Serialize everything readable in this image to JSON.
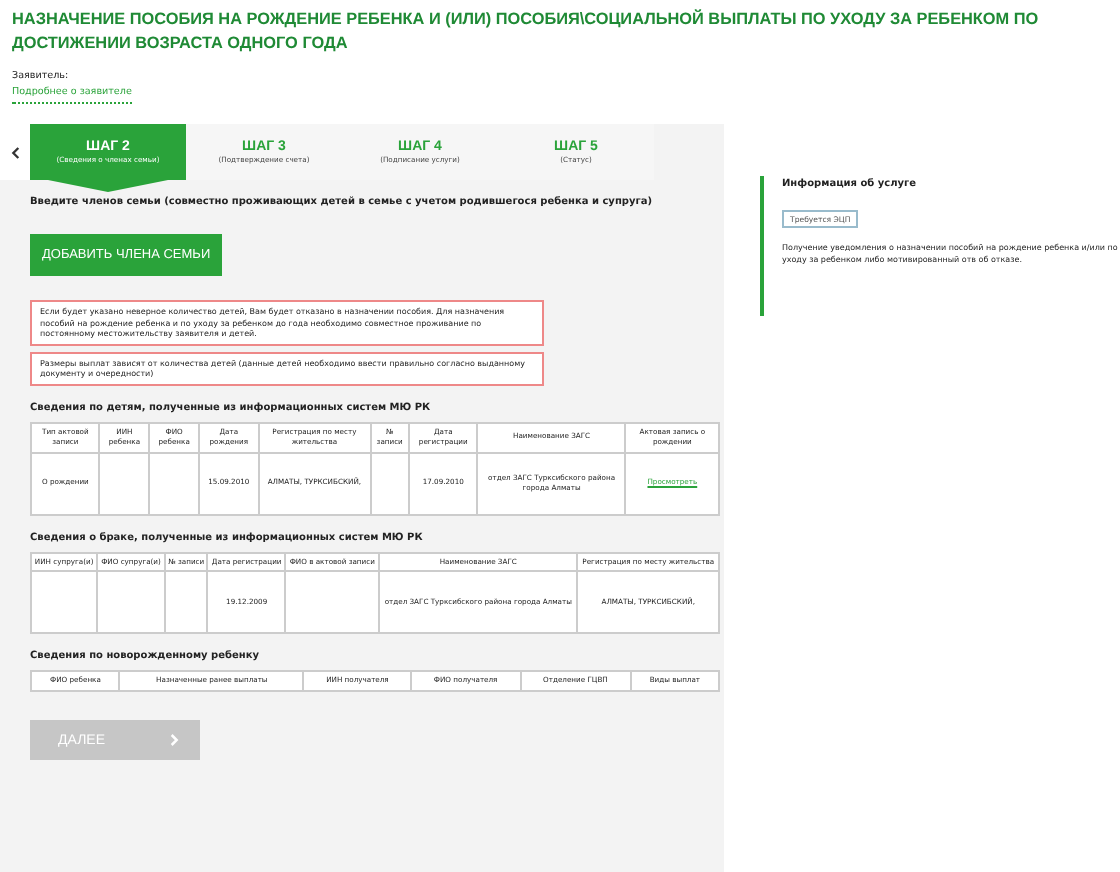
{
  "title": "НАЗНАЧЕНИЕ ПОСОБИЯ НА РОЖДЕНИЕ РЕБЕНКА И (ИЛИ) ПОСОБИЯ\\СОЦИАЛЬНОЙ ВЫПЛАТЫ ПО УХОДУ ЗА РЕБЕНКОМ ПО ДОСТИЖЕНИИ ВОЗРАСТА ОДНОГО ГОДА",
  "applicant": {
    "label": "Заявитель:",
    "link": "Подробнее о заявителе"
  },
  "steps": [
    {
      "label": "ШАГ 2",
      "caption": "(Сведения о членах семьи)",
      "selected": true
    },
    {
      "label": "ШАГ 3",
      "caption": "(Подтверждение счета)",
      "selected": false
    },
    {
      "label": "ШАГ 4",
      "caption": "(Подписание услуги)",
      "selected": false
    },
    {
      "label": "ШАГ 5",
      "caption": "(Статус)",
      "selected": false
    }
  ],
  "instruction": "Введите членов семьи (совместно проживающих детей в семье с учетом родившегося ребенка и супруга)",
  "add_button": "ДОБАВИТЬ ЧЛЕНА СЕМЬИ",
  "warnings": [
    "Если будет указано неверное количество детей, Вам будет отказано в назначении пособия. Для назначения пособий на рождение ребенка и по уходу за ребенком до года необходимо совместное проживание по постоянному местожительству заявителя и детей.",
    "Размеры выплат зависят от количества детей (данные детей необходимо ввести правильно согласно выданному документу и очередности)"
  ],
  "tables": [
    {
      "title": "Сведения по детям, полученные из информационных систем МЮ РК",
      "columns": [
        "Тип актовой записи",
        "ИИН ребенка",
        "ФИО ребенка",
        "Дата рождения",
        "Регистрация по месту жительства",
        "№ записи",
        "Дата регистрации",
        "Наименование ЗАГС",
        "Актовая запись о рождении"
      ],
      "rows": [
        [
          "О рождении",
          null,
          null,
          "15.09.2010",
          "АЛМАТЫ, ТУРКСИБСКИЙ,",
          null,
          "17.09.2010",
          "отдел ЗАГС Турксибского района города Алматы",
          {
            "link": "Просмотреть"
          }
        ]
      ]
    },
    {
      "title": "Сведения о браке, полученные из информационных систем МЮ РК",
      "columns": [
        "ИИН супруга(и)",
        "ФИО супруга(и)",
        "№ записи",
        "Дата регистрации",
        "ФИО в актовой записи",
        "Наименование ЗАГС",
        "Регистрация по месту жительства"
      ],
      "rows": [
        [
          null,
          null,
          null,
          "19.12.2009",
          null,
          "отдел ЗАГС Турксибского района города Алматы",
          "АЛМАТЫ, ТУРКСИБСКИЙ,"
        ]
      ]
    },
    {
      "title": "Сведения по новорожденному ребенку",
      "columns": [
        "ФИО ребенка",
        "Назначенные ранее выплаты",
        "ИИН получателя",
        "ФИО получателя",
        "Отделение ГЦВП",
        "Виды выплат"
      ]
    }
  ],
  "next_button": {
    "label": "ДАЛЕЕ",
    "disabled": true
  },
  "sidebar": {
    "title": "Информация об услуге",
    "badge": "Требуется ЭЦП",
    "text": "Получение уведомления о назначении пособий на рождение ребенка и/или по уходу за ребенком либо мотивированный отв об отказе."
  }
}
